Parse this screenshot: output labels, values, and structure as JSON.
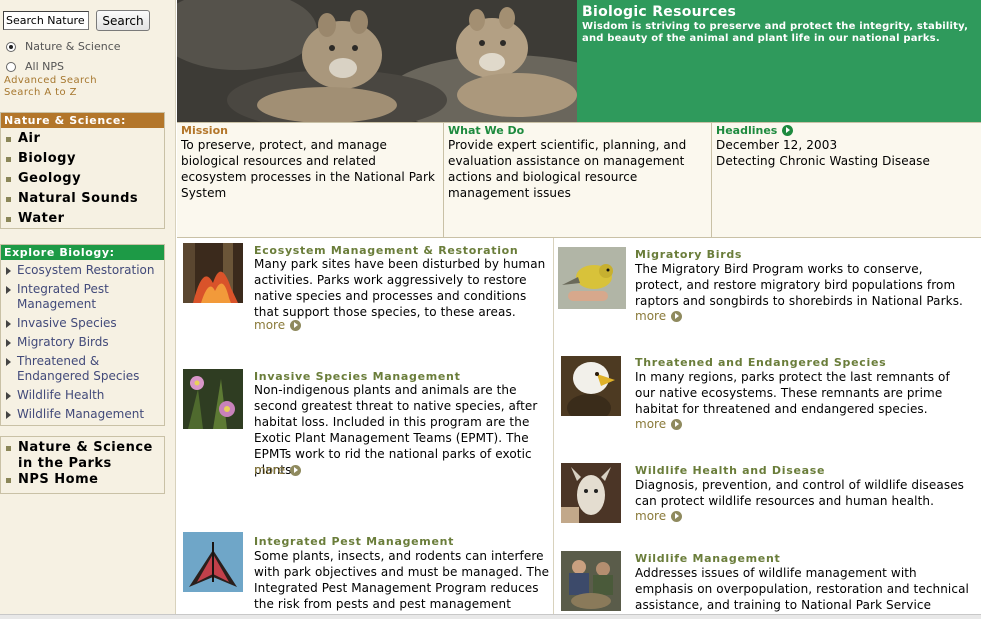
{
  "search": {
    "value": "Search Nature",
    "button": "Search"
  },
  "scope": {
    "option1": "Nature & Science",
    "option2": "All NPS"
  },
  "links": {
    "advanced": "Advanced Search",
    "atoz": "Search A to Z"
  },
  "nature_box": {
    "heading": "Nature & Science:",
    "items": [
      "Air",
      "Biology",
      "Geology",
      "Natural Sounds",
      "Water"
    ]
  },
  "explore_box": {
    "heading": "Explore Biology:",
    "items": [
      "Ecosystem Restoration",
      "Integrated Pest Management",
      "Invasive Species",
      "Migratory Birds",
      "Threatened & Endangered Species",
      "Wildlife Health",
      "Wildlife Management"
    ]
  },
  "bottom_box": {
    "items": [
      "Nature & Science in the Parks",
      "NPS Home"
    ]
  },
  "banner": {
    "title": "Biologic Resources",
    "subtitle": "Wisdom is striving to preserve and protect the integrity, stability, and beauty of the animal and plant life in our national parks."
  },
  "mission": {
    "heading": "Mission",
    "text": "To preserve, protect, and manage biological resources and related ecosystem processes in the National Park System"
  },
  "whatwedo": {
    "heading": "What We Do",
    "text": "Provide expert scientific, planning, and evaluation assistance on management actions and biological resource management issues"
  },
  "headlines": {
    "heading": "Headlines",
    "date": "December 12, 2003",
    "text": "Detecting Chronic Wasting Disease"
  },
  "more_label": "more",
  "left_items": [
    {
      "title": "Ecosystem Management & Restoration",
      "text": "Many park sites have been disturbed by human activities. Parks work aggressively to restore native species and processes and conditions that support those species, to these areas."
    },
    {
      "title": "Invasive Species Management",
      "text": "Non-indigenous plants and animals are the second greatest threat to native species, after habitat loss. Included in this program are the Exotic Plant Management Teams (EPMT). The EPMTs work to rid the national parks of exotic plants."
    },
    {
      "title": "Integrated Pest Management",
      "text": "Some plants, insects, and rodents can interfere with park objectives and must be managed. The Integrated Pest Management Program reduces the risk from pests and pest management related"
    }
  ],
  "right_items": [
    {
      "title": "Migratory Birds",
      "text": "The Migratory Bird Program works to conserve, protect, and restore migratory bird populations from raptors and songbirds to shorebirds in National Parks."
    },
    {
      "title": "Threatened and Endangered Species",
      "text": "In many regions, parks protect the last remnants of our native ecosystems. These remnants are prime habitat for threatened and endangered species."
    },
    {
      "title": "Wildlife Health and Disease",
      "text": "Diagnosis, prevention, and control of wildlife diseases can protect wildlife resources and human health."
    },
    {
      "title": "Wildlife Management",
      "text": "Addresses issues of wildlife management with emphasis on overpopulation, restoration and technical assistance, and training to National Park Service personnel for wildlife"
    }
  ]
}
